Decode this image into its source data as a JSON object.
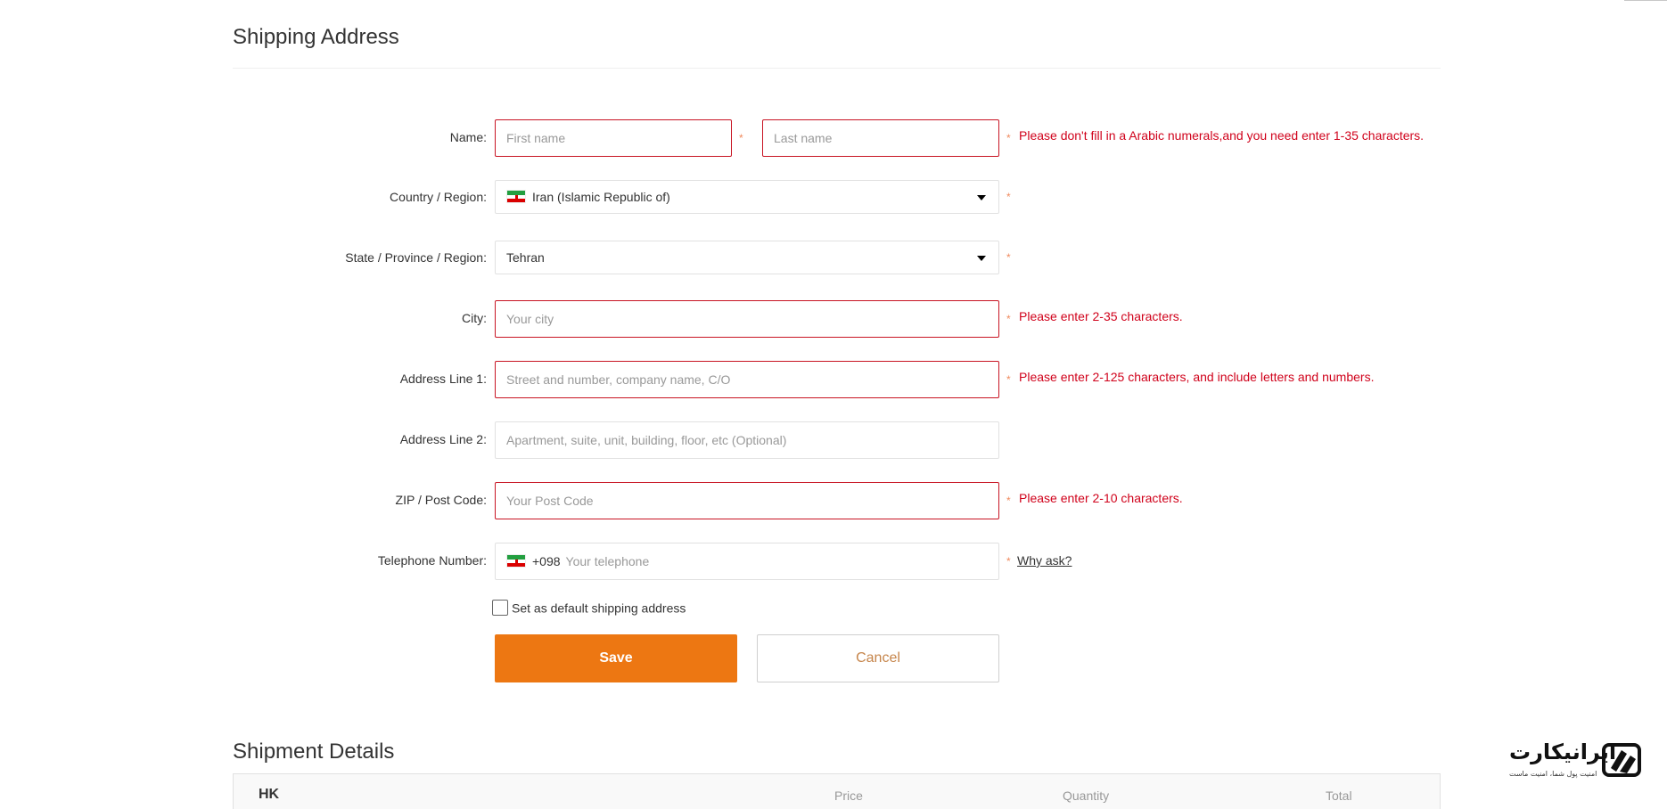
{
  "shipping": {
    "title": "Shipping Address",
    "name": {
      "label": "Name:",
      "first_placeholder": "First name",
      "last_placeholder": "Last name",
      "error": "Please don't fill in a Arabic numerals,and you need enter 1-35 characters."
    },
    "country": {
      "label": "Country / Region:",
      "value": "Iran (Islamic Republic of)",
      "flag": "iran-flag"
    },
    "state": {
      "label": "State / Province / Region:",
      "value": "Tehran"
    },
    "city": {
      "label": "City:",
      "placeholder": "Your city",
      "error": "Please enter 2-35 characters."
    },
    "address1": {
      "label": "Address Line 1:",
      "placeholder": "Street and number, company name, C/O",
      "error": "Please enter 2-125 characters, and include letters and numbers."
    },
    "address2": {
      "label": "Address Line 2:",
      "placeholder": "Apartment, suite, unit, building, floor, etc (Optional)"
    },
    "zip": {
      "label": "ZIP / Post Code:",
      "placeholder": "Your Post Code",
      "error": "Please enter 2-10 characters."
    },
    "phone": {
      "label": "Telephone Number:",
      "code": "+098",
      "placeholder": "Your telephone",
      "why_ask": "Why ask?"
    },
    "required_mark": "*",
    "default_checkbox_label": "Set as default shipping address",
    "save_label": "Save",
    "cancel_label": "Cancel"
  },
  "shipment": {
    "title": "Shipment Details",
    "seller": "HK",
    "columns": [
      "Price",
      "Quantity",
      "Total"
    ]
  },
  "watermark": {
    "name": "ایرانیکارت",
    "tagline": "امنیت پول شما، امنیت ماست"
  },
  "colors": {
    "error": "#d0021b",
    "error_border": "#c81423",
    "primary_button": "#ed7712",
    "cancel_text": "#c6854b"
  }
}
